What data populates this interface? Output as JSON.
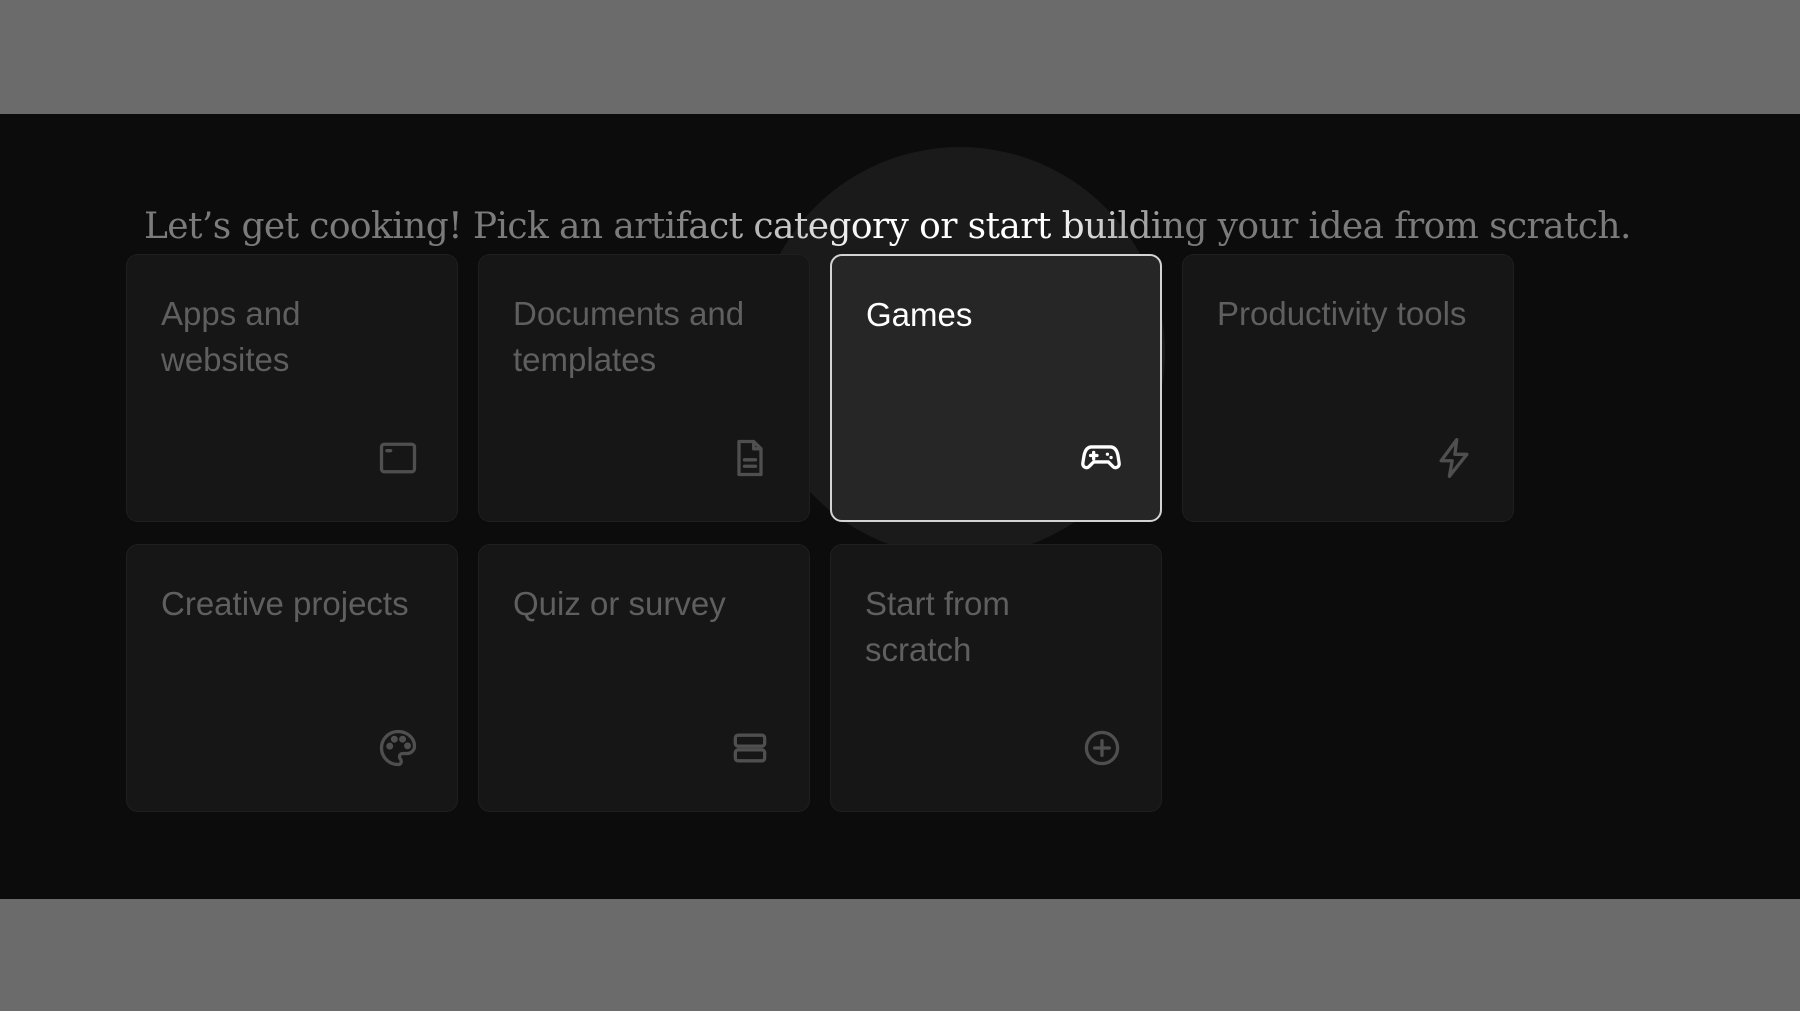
{
  "headline": "Let’s get cooking! Pick an artifact category or start building your idea from scratch.",
  "categories": [
    {
      "label": "Apps and websites",
      "icon": "browser-window-icon"
    },
    {
      "label": "Documents and templates",
      "icon": "document-icon"
    },
    {
      "label": "Games",
      "icon": "gamepad-icon",
      "selected": true
    },
    {
      "label": "Productivity tools",
      "icon": "lightning-bolt-icon"
    },
    {
      "label": "Creative projects",
      "icon": "palette-icon"
    },
    {
      "label": "Quiz or survey",
      "icon": "stacked-bars-icon"
    },
    {
      "label": "Start from scratch",
      "icon": "plus-circle-icon"
    }
  ],
  "colors": {
    "background": "#0c0c0c",
    "card": "#161616",
    "card_selected": "#262626",
    "selected_border": "#d4d4d4",
    "text_dim": "#5f5f5f",
    "text_bright": "#ffffff"
  }
}
